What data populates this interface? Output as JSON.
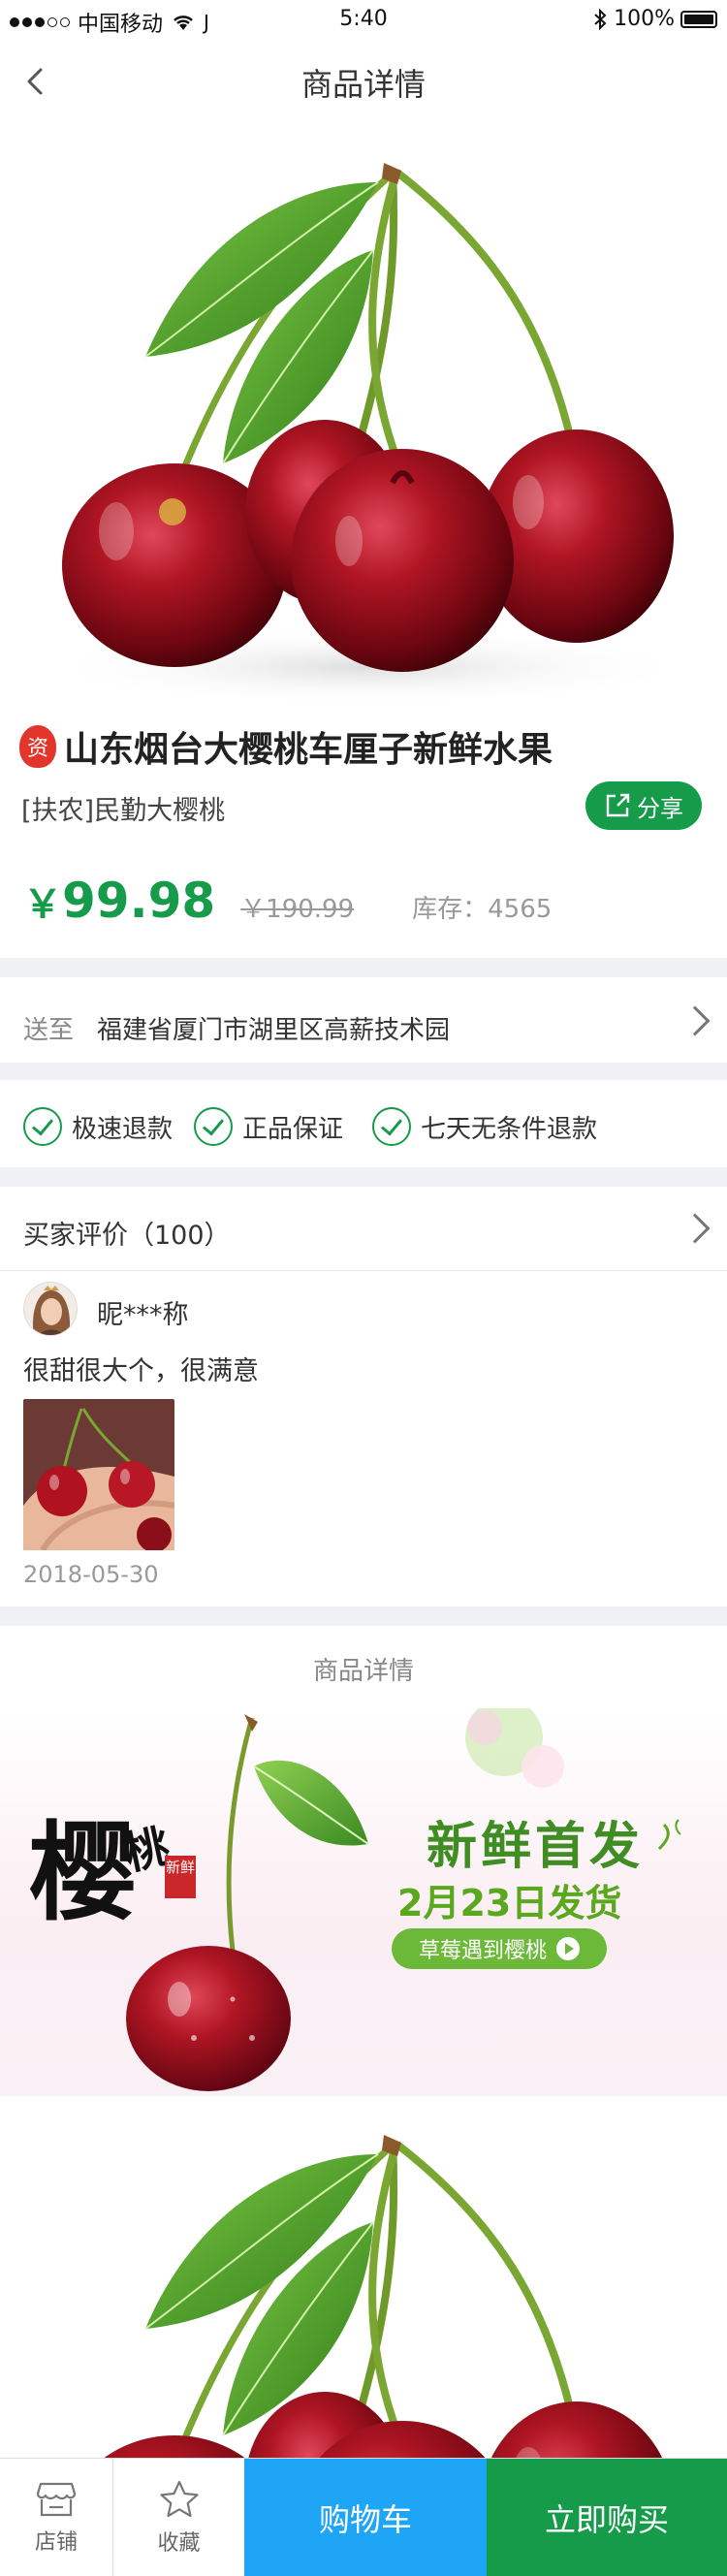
{
  "status_bar": {
    "carrier": "中国移动",
    "time": "5:40",
    "battery": "100%"
  },
  "nav": {
    "title": "商品详情"
  },
  "product": {
    "tag": "资",
    "title": "山东烟台大樱桃车厘子新鲜水果",
    "subtitle": "[扶农]民勤大樱桃",
    "share_label": "分享",
    "currency": "￥",
    "price": "99.98",
    "old_price": "￥190.99",
    "stock": "库存：4565"
  },
  "delivery": {
    "label": "送至",
    "address": "福建省厦门市湖里区高薪技术园"
  },
  "guarantees": [
    "极速退款",
    "正品保证",
    "七天无条件退款"
  ],
  "reviews": {
    "header": "买家评价（100）",
    "user": "昵***称",
    "text": "很甜很大个，很满意",
    "date": "2018-05-30"
  },
  "details": {
    "header": "商品详情",
    "banner": {
      "ying": "樱",
      "tao": "桃",
      "seal": "新鲜",
      "title": "新鲜首发",
      "date_line": "2月23日发货",
      "pill": "草莓遇到樱桃"
    }
  },
  "bottom_bar": {
    "store": "店铺",
    "favorite": "收藏",
    "cart": "购物车",
    "buy": "立即购买"
  },
  "colors": {
    "brand_green": "#159b4a",
    "cart_blue": "#1ea5f5",
    "cherry_red": "#a8121f"
  },
  "icons": [
    "back-arrow-icon",
    "wifi-icon",
    "bluetooth-icon",
    "battery-icon",
    "share-icon",
    "check-circle-icon",
    "chevron-right-icon",
    "store-icon",
    "star-icon",
    "play-icon"
  ]
}
